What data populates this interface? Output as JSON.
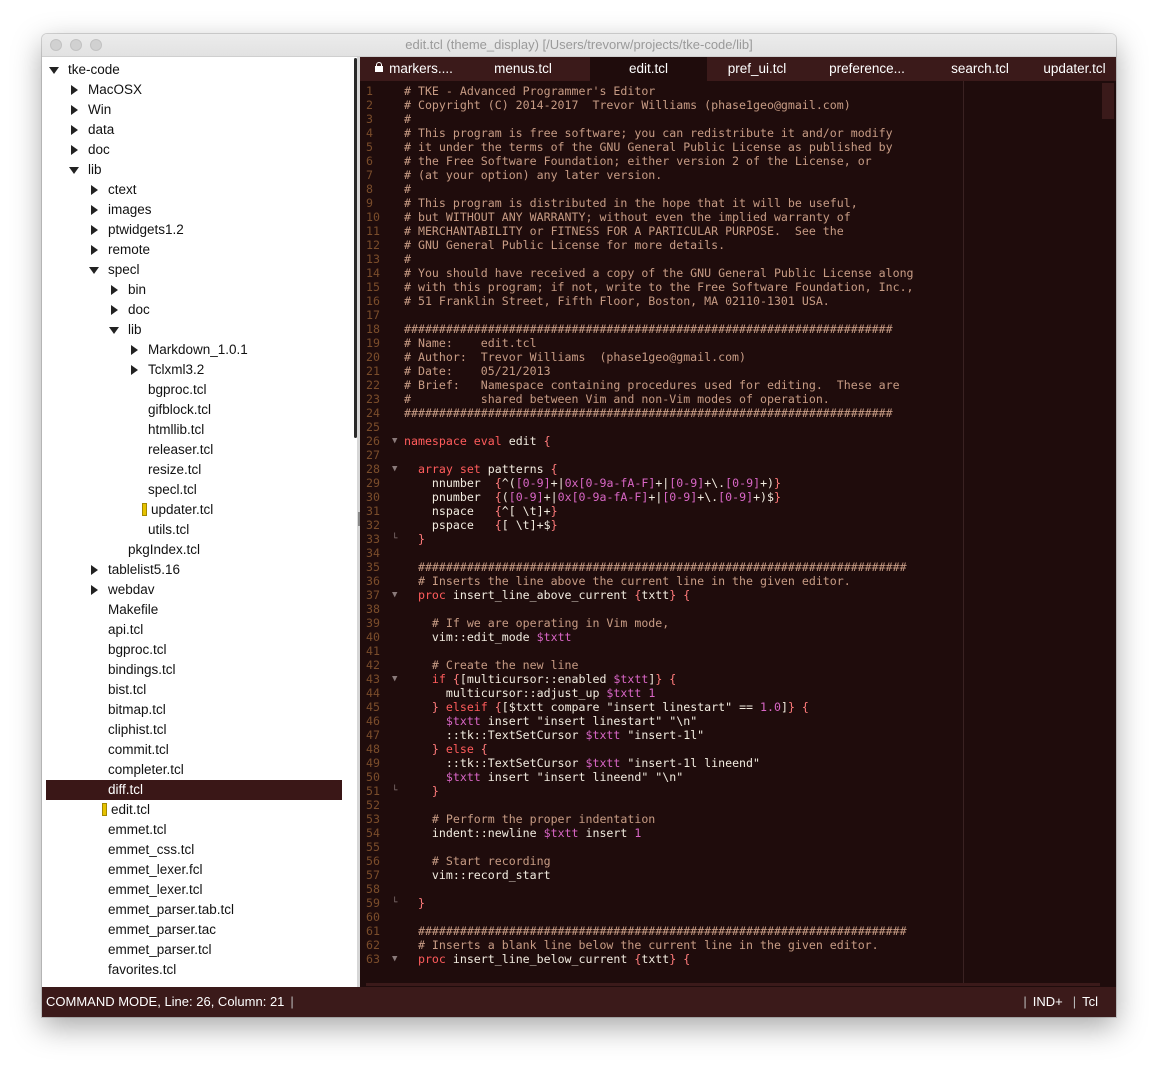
{
  "window": {
    "title": "edit.tcl (theme_display) [/Users/trevorw/projects/tke-code/lib]"
  },
  "sidebar": {
    "items": [
      {
        "label": "tke-code",
        "depth": 0,
        "toggle": "down"
      },
      {
        "label": "MacOSX",
        "depth": 1,
        "toggle": "right"
      },
      {
        "label": "Win",
        "depth": 1,
        "toggle": "right"
      },
      {
        "label": "data",
        "depth": 1,
        "toggle": "right"
      },
      {
        "label": "doc",
        "depth": 1,
        "toggle": "right"
      },
      {
        "label": "lib",
        "depth": 1,
        "toggle": "down"
      },
      {
        "label": "ctext",
        "depth": 2,
        "toggle": "right"
      },
      {
        "label": "images",
        "depth": 2,
        "toggle": "right"
      },
      {
        "label": "ptwidgets1.2",
        "depth": 2,
        "toggle": "right"
      },
      {
        "label": "remote",
        "depth": 2,
        "toggle": "right"
      },
      {
        "label": "specl",
        "depth": 2,
        "toggle": "down"
      },
      {
        "label": "bin",
        "depth": 3,
        "toggle": "right"
      },
      {
        "label": "doc",
        "depth": 3,
        "toggle": "right"
      },
      {
        "label": "lib",
        "depth": 3,
        "toggle": "down"
      },
      {
        "label": "Markdown_1.0.1",
        "depth": 4,
        "toggle": "right"
      },
      {
        "label": "Tclxml3.2",
        "depth": 4,
        "toggle": "right"
      },
      {
        "label": "bgproc.tcl",
        "depth": 4,
        "toggle": "none"
      },
      {
        "label": "gifblock.tcl",
        "depth": 4,
        "toggle": "none"
      },
      {
        "label": "htmllib.tcl",
        "depth": 4,
        "toggle": "none"
      },
      {
        "label": "releaser.tcl",
        "depth": 4,
        "toggle": "none"
      },
      {
        "label": "resize.tcl",
        "depth": 4,
        "toggle": "none"
      },
      {
        "label": "specl.tcl",
        "depth": 4,
        "toggle": "none"
      },
      {
        "label": "updater.tcl",
        "depth": 4,
        "toggle": "none",
        "marked": true
      },
      {
        "label": "utils.tcl",
        "depth": 4,
        "toggle": "none"
      },
      {
        "label": "pkgIndex.tcl",
        "depth": 3,
        "toggle": "none"
      },
      {
        "label": "tablelist5.16",
        "depth": 2,
        "toggle": "right"
      },
      {
        "label": "webdav",
        "depth": 2,
        "toggle": "right"
      },
      {
        "label": "Makefile",
        "depth": 2,
        "toggle": "none"
      },
      {
        "label": "api.tcl",
        "depth": 2,
        "toggle": "none"
      },
      {
        "label": "bgproc.tcl",
        "depth": 2,
        "toggle": "none"
      },
      {
        "label": "bindings.tcl",
        "depth": 2,
        "toggle": "none"
      },
      {
        "label": "bist.tcl",
        "depth": 2,
        "toggle": "none"
      },
      {
        "label": "bitmap.tcl",
        "depth": 2,
        "toggle": "none"
      },
      {
        "label": "cliphist.tcl",
        "depth": 2,
        "toggle": "none"
      },
      {
        "label": "commit.tcl",
        "depth": 2,
        "toggle": "none"
      },
      {
        "label": "completer.tcl",
        "depth": 2,
        "toggle": "none"
      },
      {
        "label": "diff.tcl",
        "depth": 2,
        "toggle": "none",
        "selected": true
      },
      {
        "label": "edit.tcl",
        "depth": 2,
        "toggle": "none",
        "marked": true
      },
      {
        "label": "emmet.tcl",
        "depth": 2,
        "toggle": "none"
      },
      {
        "label": "emmet_css.tcl",
        "depth": 2,
        "toggle": "none"
      },
      {
        "label": "emmet_lexer.fcl",
        "depth": 2,
        "toggle": "none"
      },
      {
        "label": "emmet_lexer.tcl",
        "depth": 2,
        "toggle": "none"
      },
      {
        "label": "emmet_parser.tab.tcl",
        "depth": 2,
        "toggle": "none"
      },
      {
        "label": "emmet_parser.tac",
        "depth": 2,
        "toggle": "none"
      },
      {
        "label": "emmet_parser.tcl",
        "depth": 2,
        "toggle": "none"
      },
      {
        "label": "favorites.tcl",
        "depth": 2,
        "toggle": "none"
      }
    ]
  },
  "tabs": [
    {
      "label": "markers....",
      "locked": true,
      "active": false
    },
    {
      "label": "menus.tcl",
      "active": false
    },
    {
      "label": "edit.tcl",
      "active": true
    },
    {
      "label": "pref_ui.tcl",
      "active": false
    },
    {
      "label": "preference...",
      "active": false
    },
    {
      "label": "search.tcl",
      "active": false
    },
    {
      "label": "updater.tcl",
      "active": false
    }
  ],
  "code": {
    "lines": [
      [
        [
          "c",
          "# TKE - Advanced Programmer's Editor"
        ]
      ],
      [
        [
          "c",
          "# Copyright (C) 2014-2017  Trevor Williams (phase1geo@gmail.com)"
        ]
      ],
      [
        [
          "c",
          "#"
        ]
      ],
      [
        [
          "c",
          "# This program is free software; you can redistribute it and/or modify"
        ]
      ],
      [
        [
          "c",
          "# it under the terms of the GNU General Public License as published by"
        ]
      ],
      [
        [
          "c",
          "# the Free Software Foundation; either version 2 of the License, or"
        ]
      ],
      [
        [
          "c",
          "# (at your option) any later version."
        ]
      ],
      [
        [
          "c",
          "#"
        ]
      ],
      [
        [
          "c",
          "# This program is distributed in the hope that it will be useful,"
        ]
      ],
      [
        [
          "c",
          "# but WITHOUT ANY WARRANTY; without even the implied warranty of"
        ]
      ],
      [
        [
          "c",
          "# MERCHANTABILITY or FITNESS FOR A PARTICULAR PURPOSE.  See the"
        ]
      ],
      [
        [
          "c",
          "# GNU General Public License for more details."
        ]
      ],
      [
        [
          "c",
          "#"
        ]
      ],
      [
        [
          "c",
          "# You should have received a copy of the GNU General Public License along"
        ]
      ],
      [
        [
          "c",
          "# with this program; if not, write to the Free Software Foundation, Inc.,"
        ]
      ],
      [
        [
          "c",
          "# 51 Franklin Street, Fifth Floor, Boston, MA 02110-1301 USA."
        ]
      ],
      [],
      [
        [
          "c",
          "######################################################################"
        ]
      ],
      [
        [
          "c",
          "# Name:    edit.tcl"
        ]
      ],
      [
        [
          "c",
          "# Author:  Trevor Williams  (phase1geo@gmail.com)"
        ]
      ],
      [
        [
          "c",
          "# Date:    05/21/2013"
        ]
      ],
      [
        [
          "c",
          "# Brief:   Namespace containing procedures used for editing.  These are"
        ]
      ],
      [
        [
          "c",
          "#          shared between Vim and non-Vim modes of operation."
        ]
      ],
      [
        [
          "c",
          "######################################################################"
        ]
      ],
      [],
      [
        [
          "k",
          "namespace eval"
        ],
        [
          "t",
          " edit "
        ],
        [
          "b",
          "{"
        ]
      ],
      [],
      [
        [
          "t",
          "  "
        ],
        [
          "k",
          "array set"
        ],
        [
          "t",
          " patterns "
        ],
        [
          "b",
          "{"
        ]
      ],
      [
        [
          "t",
          "    nnumber  "
        ],
        [
          "b",
          "{"
        ],
        [
          "t",
          "^("
        ],
        [
          "n",
          "[0-9]"
        ],
        [
          "t",
          "+|"
        ],
        [
          "n",
          "0x"
        ],
        [
          "n",
          "[0-9a-fA-F]"
        ],
        [
          "t",
          "+|"
        ],
        [
          "n",
          "[0-9]"
        ],
        [
          "t",
          "+\\."
        ],
        [
          "n",
          "[0-9]"
        ],
        [
          "t",
          "+)"
        ],
        [
          "b",
          "}"
        ]
      ],
      [
        [
          "t",
          "    pnumber  "
        ],
        [
          "b",
          "{"
        ],
        [
          "t",
          "("
        ],
        [
          "n",
          "[0-9]"
        ],
        [
          "t",
          "+|"
        ],
        [
          "n",
          "0x"
        ],
        [
          "n",
          "[0-9a-fA-F]"
        ],
        [
          "t",
          "+|"
        ],
        [
          "n",
          "[0-9]"
        ],
        [
          "t",
          "+\\."
        ],
        [
          "n",
          "[0-9]"
        ],
        [
          "t",
          "+)$"
        ],
        [
          "b",
          "}"
        ]
      ],
      [
        [
          "t",
          "    nspace   "
        ],
        [
          "b",
          "{"
        ],
        [
          "t",
          "^[ \\t]+"
        ],
        [
          "b",
          "}"
        ]
      ],
      [
        [
          "t",
          "    pspace   "
        ],
        [
          "b",
          "{"
        ],
        [
          "t",
          "[ \\t]+$"
        ],
        [
          "b",
          "}"
        ]
      ],
      [
        [
          "t",
          "  "
        ],
        [
          "b",
          "}"
        ]
      ],
      [],
      [
        [
          "c",
          "  ######################################################################"
        ]
      ],
      [
        [
          "c",
          "  # Inserts the line above the current line in the given editor."
        ]
      ],
      [
        [
          "t",
          "  "
        ],
        [
          "k",
          "proc"
        ],
        [
          "t",
          " insert_line_above_current "
        ],
        [
          "b",
          "{"
        ],
        [
          "t",
          "txtt"
        ],
        [
          "b",
          "}"
        ],
        [
          "t",
          " "
        ],
        [
          "b",
          "{"
        ]
      ],
      [],
      [
        [
          "c",
          "    # If we are operating in Vim mode,"
        ]
      ],
      [
        [
          "t",
          "    vim::edit_mode "
        ],
        [
          "v",
          "$txtt"
        ]
      ],
      [],
      [
        [
          "c",
          "    # Create the new line"
        ]
      ],
      [
        [
          "t",
          "    "
        ],
        [
          "k",
          "if"
        ],
        [
          "t",
          " "
        ],
        [
          "b",
          "{"
        ],
        [
          "t",
          "[multicursor::enabled "
        ],
        [
          "v",
          "$txtt"
        ],
        [
          "t",
          "]"
        ],
        [
          "b",
          "}"
        ],
        [
          "t",
          " "
        ],
        [
          "b",
          "{"
        ]
      ],
      [
        [
          "t",
          "      multicursor::adjust_up "
        ],
        [
          "v",
          "$txtt"
        ],
        [
          "t",
          " "
        ],
        [
          "n",
          "1"
        ]
      ],
      [
        [
          "t",
          "    "
        ],
        [
          "b",
          "}"
        ],
        [
          "t",
          " "
        ],
        [
          "k",
          "elseif"
        ],
        [
          "t",
          " "
        ],
        [
          "b",
          "{"
        ],
        [
          "t",
          "[$txtt compare \"insert linestart\" == "
        ],
        [
          "n",
          "1.0"
        ],
        [
          "t",
          "]"
        ],
        [
          "b",
          "}"
        ],
        [
          "t",
          " "
        ],
        [
          "b",
          "{"
        ]
      ],
      [
        [
          "t",
          "      "
        ],
        [
          "v",
          "$txtt"
        ],
        [
          "t",
          " insert \"insert linestart\" \"\\n\""
        ]
      ],
      [
        [
          "t",
          "      ::tk::TextSetCursor "
        ],
        [
          "v",
          "$txtt"
        ],
        [
          "t",
          " \"insert-1l\""
        ]
      ],
      [
        [
          "t",
          "    "
        ],
        [
          "b",
          "}"
        ],
        [
          "t",
          " "
        ],
        [
          "k",
          "else"
        ],
        [
          "t",
          " "
        ],
        [
          "b",
          "{"
        ]
      ],
      [
        [
          "t",
          "      ::tk::TextSetCursor "
        ],
        [
          "v",
          "$txtt"
        ],
        [
          "t",
          " \"insert-1l lineend\""
        ]
      ],
      [
        [
          "t",
          "      "
        ],
        [
          "v",
          "$txtt"
        ],
        [
          "t",
          " insert \"insert lineend\" \"\\n\""
        ]
      ],
      [
        [
          "t",
          "    "
        ],
        [
          "b",
          "}"
        ]
      ],
      [],
      [
        [
          "c",
          "    # Perform the proper indentation"
        ]
      ],
      [
        [
          "t",
          "    indent::newline "
        ],
        [
          "v",
          "$txtt"
        ],
        [
          "t",
          " insert "
        ],
        [
          "n",
          "1"
        ]
      ],
      [],
      [
        [
          "c",
          "    # Start recording"
        ]
      ],
      [
        [
          "t",
          "    vim::record_start"
        ]
      ],
      [],
      [
        [
          "t",
          "  "
        ],
        [
          "b",
          "}"
        ]
      ],
      [],
      [
        [
          "c",
          "  ######################################################################"
        ]
      ],
      [
        [
          "c",
          "  # Inserts a blank line below the current line in the given editor."
        ]
      ],
      [
        [
          "t",
          "  "
        ],
        [
          "k",
          "proc"
        ],
        [
          "t",
          " insert_line_below_current "
        ],
        [
          "b",
          "{"
        ],
        [
          "t",
          "txtt"
        ],
        [
          "b",
          "}"
        ],
        [
          "t",
          " "
        ],
        [
          "b",
          "{"
        ]
      ]
    ],
    "fold_open": [
      26,
      28,
      37,
      43
    ],
    "fold_end": [
      33,
      51,
      59
    ],
    "fold_tail": [
      63
    ]
  },
  "status": {
    "mode": "COMMAND MODE, Line: 26, Column: 21",
    "indent": "IND+",
    "language": "Tcl"
  },
  "colors": {
    "editor_bg": "#1f0c0c",
    "tabbar_bg": "#3b1a1a",
    "comment": "#c79b84",
    "keyword": "#ff5c5c",
    "variable": "#d866c5",
    "line_number": "#7b4d2b"
  }
}
